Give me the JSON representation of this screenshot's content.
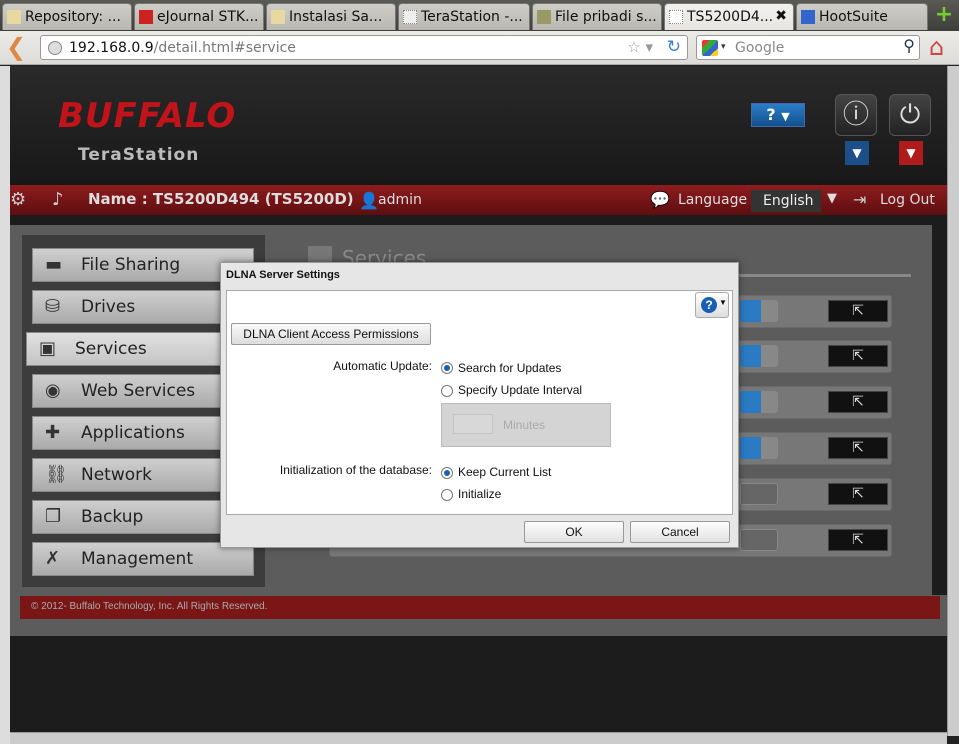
{
  "browser": {
    "tabs": [
      {
        "label": "Repository: ..."
      },
      {
        "label": "eJournal STK..."
      },
      {
        "label": "Instalasi Sa..."
      },
      {
        "label": "TeraStation -..."
      },
      {
        "label": "File pribadi s..."
      },
      {
        "label": "TS5200D4..."
      },
      {
        "label": "HootSuite"
      }
    ],
    "url_host": "192.168.0.9",
    "url_path": "/detail.html#service",
    "search_placeholder": "Google"
  },
  "header": {
    "brand": "BUFFALO",
    "product": "TeraStation",
    "help_label": "?",
    "name_label": "Name : TS5200D494 (TS5200D)",
    "user": "admin",
    "language_label": "Language",
    "language_value": "English",
    "logout_label": "Log Out"
  },
  "sidebar": {
    "items": [
      {
        "label": "File Sharing",
        "icon": "folder-icon"
      },
      {
        "label": "Drives",
        "icon": "drive-icon"
      },
      {
        "label": "Services",
        "icon": "services-icon"
      },
      {
        "label": "Web Services",
        "icon": "web-services-icon"
      },
      {
        "label": "Applications",
        "icon": "applications-icon"
      },
      {
        "label": "Network",
        "icon": "network-icon"
      },
      {
        "label": "Backup",
        "icon": "backup-icon"
      },
      {
        "label": "Management",
        "icon": "wrench-icon"
      }
    ]
  },
  "services": {
    "title": "Services"
  },
  "dialog": {
    "title": "DLNA Server Settings",
    "permissions_button": "DLNA Client Access Permissions",
    "auto_update_label": "Automatic Update:",
    "opt_search": "Search for Updates",
    "opt_interval": "Specify Update Interval",
    "minutes_label": "Minutes",
    "init_label": "Initialization of the database:",
    "opt_keep": "Keep Current List",
    "opt_initialize": "Initialize",
    "ok_label": "OK",
    "cancel_label": "Cancel"
  },
  "footer": {
    "copyright": "© 2012- Buffalo Technology, Inc. All Rights Reserved."
  }
}
